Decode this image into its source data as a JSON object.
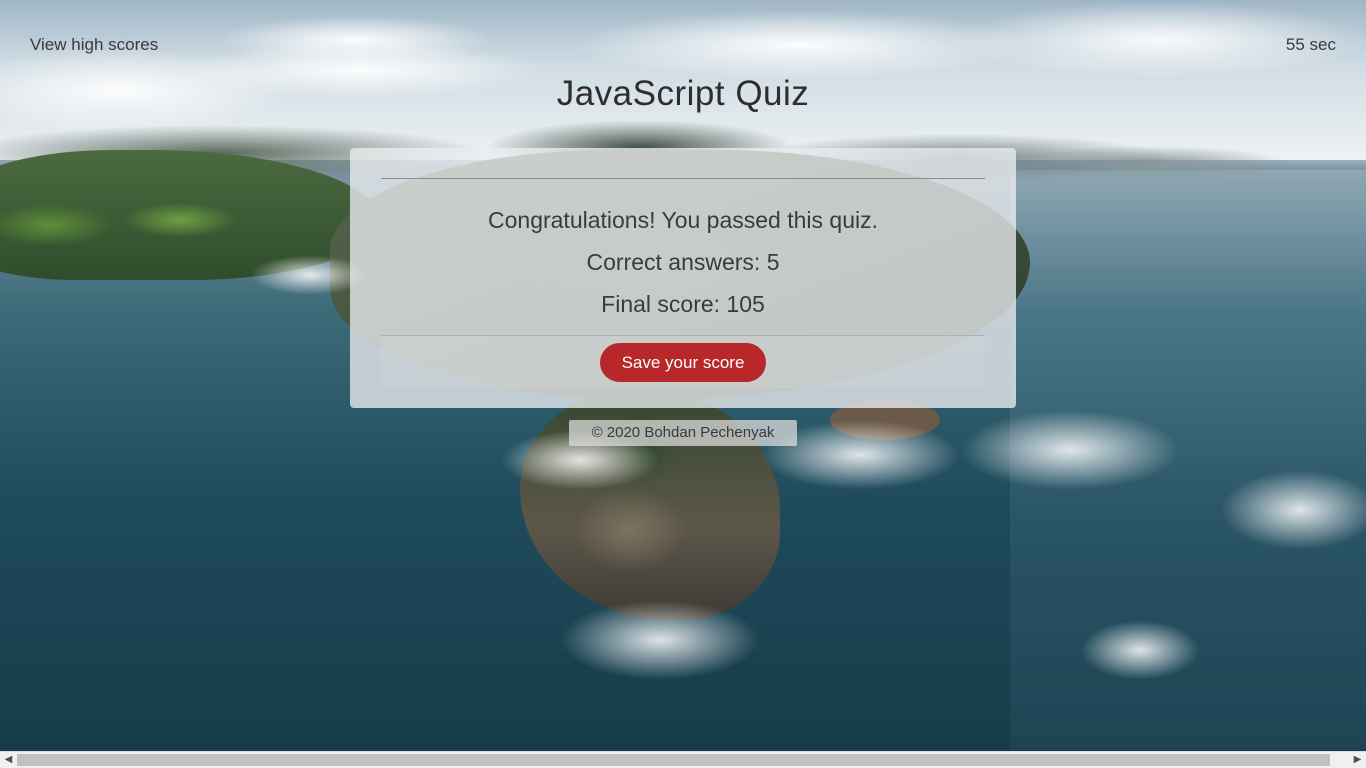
{
  "header": {
    "high_scores_link": "View high scores",
    "timer": "55 sec",
    "title": "JavaScript Quiz"
  },
  "result": {
    "message": "Congratulations! You passed this quiz.",
    "correct_answers": "Correct answers: 5",
    "final_score": "Final score: 105",
    "save_button": "Save your score"
  },
  "footer": {
    "copyright": "© 2020 Bohdan Pechenyak"
  },
  "scrollbar": {
    "left_arrow": "◀",
    "right_arrow": "▶"
  },
  "colors": {
    "save_button": "#b8282a",
    "card_background": "#ebedf0",
    "text": "#3b3b3b"
  }
}
